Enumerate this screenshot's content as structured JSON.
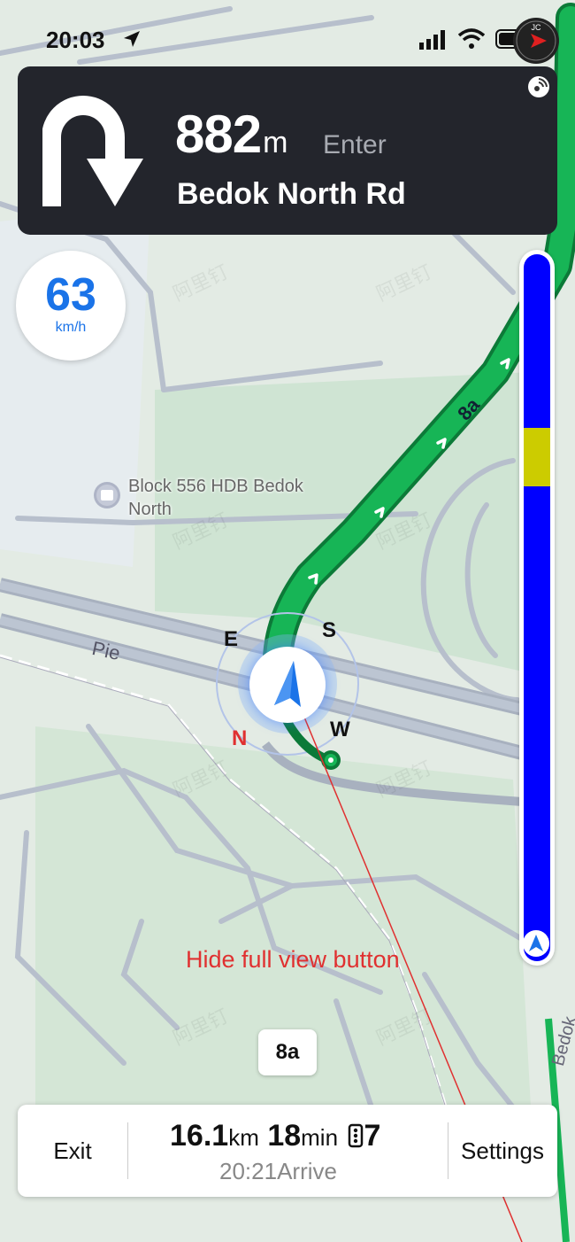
{
  "status_bar": {
    "time": "20:03"
  },
  "navigation": {
    "maneuver_icon": "u-turn-icon",
    "distance": "882",
    "distance_unit": "m",
    "action": "Enter",
    "road_name": "Bedok North Rd"
  },
  "speed": {
    "value": "63",
    "unit": "km/h"
  },
  "map": {
    "poi_label": "Block 556 HDB Bedok North",
    "road_pie": "Pie",
    "route_label": "8a",
    "road_bedok_partial": "Bedok",
    "compass": {
      "n": "N",
      "e": "E",
      "s": "S",
      "w": "W"
    }
  },
  "progress_bar": {
    "colors": {
      "track": "#0000ff",
      "segment": "#cccc00"
    },
    "segment_start_fraction": 0.246,
    "segment_end_fraction": 0.328
  },
  "annotation": "Hide full view button",
  "route_badge": "8a",
  "trip": {
    "exit_label": "Exit",
    "distance": "16.1",
    "distance_unit": "km",
    "duration": "18",
    "duration_unit": "min",
    "traffic_lights": "7",
    "arrive": "20:21Arrive",
    "settings_label": "Settings"
  },
  "colors": {
    "route": "#17b556",
    "nav_card": "#23252c",
    "accent": "#1a73e8",
    "annotation": "#e03030"
  }
}
